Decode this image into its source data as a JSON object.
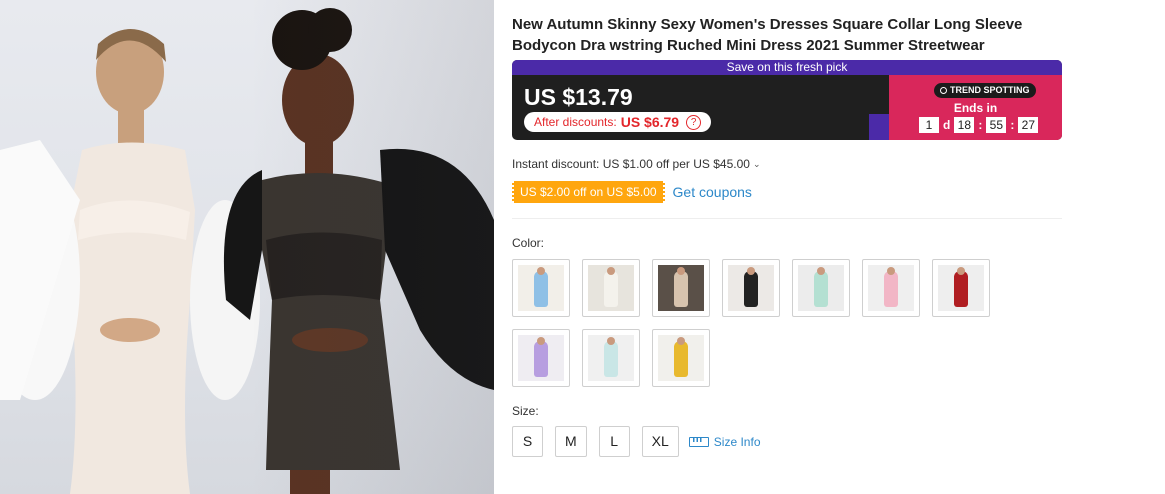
{
  "product": {
    "title": "New Autumn Skinny Sexy Women's Dresses Square Collar Long Sleeve Bodycon Dra wstring Ruched Mini Dress 2021 Summer Streetwear"
  },
  "promo": {
    "banner": "Save on this fresh pick",
    "price": "US $13.79",
    "after_label": "After discounts:",
    "after_price": "US $6.79",
    "help_icon": "question-icon",
    "badge_text": "TREND SPOTTING",
    "ends_in": "Ends in",
    "countdown": {
      "days": "1",
      "days_unit": "d",
      "hours": "18",
      "minutes": "55",
      "seconds": "27"
    },
    "colors": {
      "banner": "#4b2aa8",
      "trend": "#d9275b",
      "price_bg": "#1f1f1f"
    }
  },
  "discounts": {
    "instant": "Instant discount: US $1.00 off per US $45.00",
    "coupon": "US $2.00 off on US $5.00",
    "get_coupons": "Get coupons",
    "coupon_color": "#ffa60e"
  },
  "color": {
    "label": "Color:",
    "options": [
      {
        "dress": "#8fc0e6",
        "bg": "#f2efe9"
      },
      {
        "dress": "#f4f2ec",
        "bg": "#e7e4dd"
      },
      {
        "dress": "#d7c3ae",
        "bg": "#5a5048"
      },
      {
        "dress": "#222222",
        "bg": "#ece9e6"
      },
      {
        "dress": "#b4e0d2",
        "bg": "#ececec"
      },
      {
        "dress": "#f2b6c6",
        "bg": "#efefef"
      },
      {
        "dress": "#b01e22",
        "bg": "#eeeeee"
      },
      {
        "dress": "#b79ee0",
        "bg": "#efedf2"
      },
      {
        "dress": "#c9e6e6",
        "bg": "#f0f0f0"
      },
      {
        "dress": "#e8b92e",
        "bg": "#f1f0ec"
      }
    ]
  },
  "size": {
    "label": "Size:",
    "options": [
      "S",
      "M",
      "L",
      "XL"
    ],
    "info": "Size Info"
  }
}
